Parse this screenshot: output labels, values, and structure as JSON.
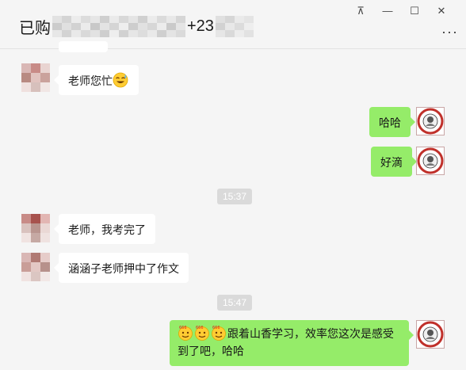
{
  "window": {
    "title_prefix": "已购",
    "title_suffix": "+23",
    "pin_glyph": "⊼",
    "minimize_glyph": "—",
    "maximize_glyph": "☐",
    "close_glyph": "✕",
    "more_glyph": "···"
  },
  "messages": {
    "m1": "老师您忙",
    "m2": "哈哈",
    "m3": "好滴",
    "t1": "15:37",
    "m4": "老师，我考完了",
    "m5": "涵涵子老师押中了作文",
    "t2": "15:47",
    "m6_line1": "跟着山香学习，效率您这次是感受",
    "m6_line2": "到了吧，哈哈",
    "emoji_badge": "666"
  },
  "icons": {
    "sweat_smile": "sweat-smile-emoji",
    "thumbs_666": "666-emoji"
  },
  "colors": {
    "bg": "#f5f5f5",
    "out_bubble": "#95ec69",
    "in_bubble": "#ffffff",
    "time_chip": "#dadada"
  }
}
